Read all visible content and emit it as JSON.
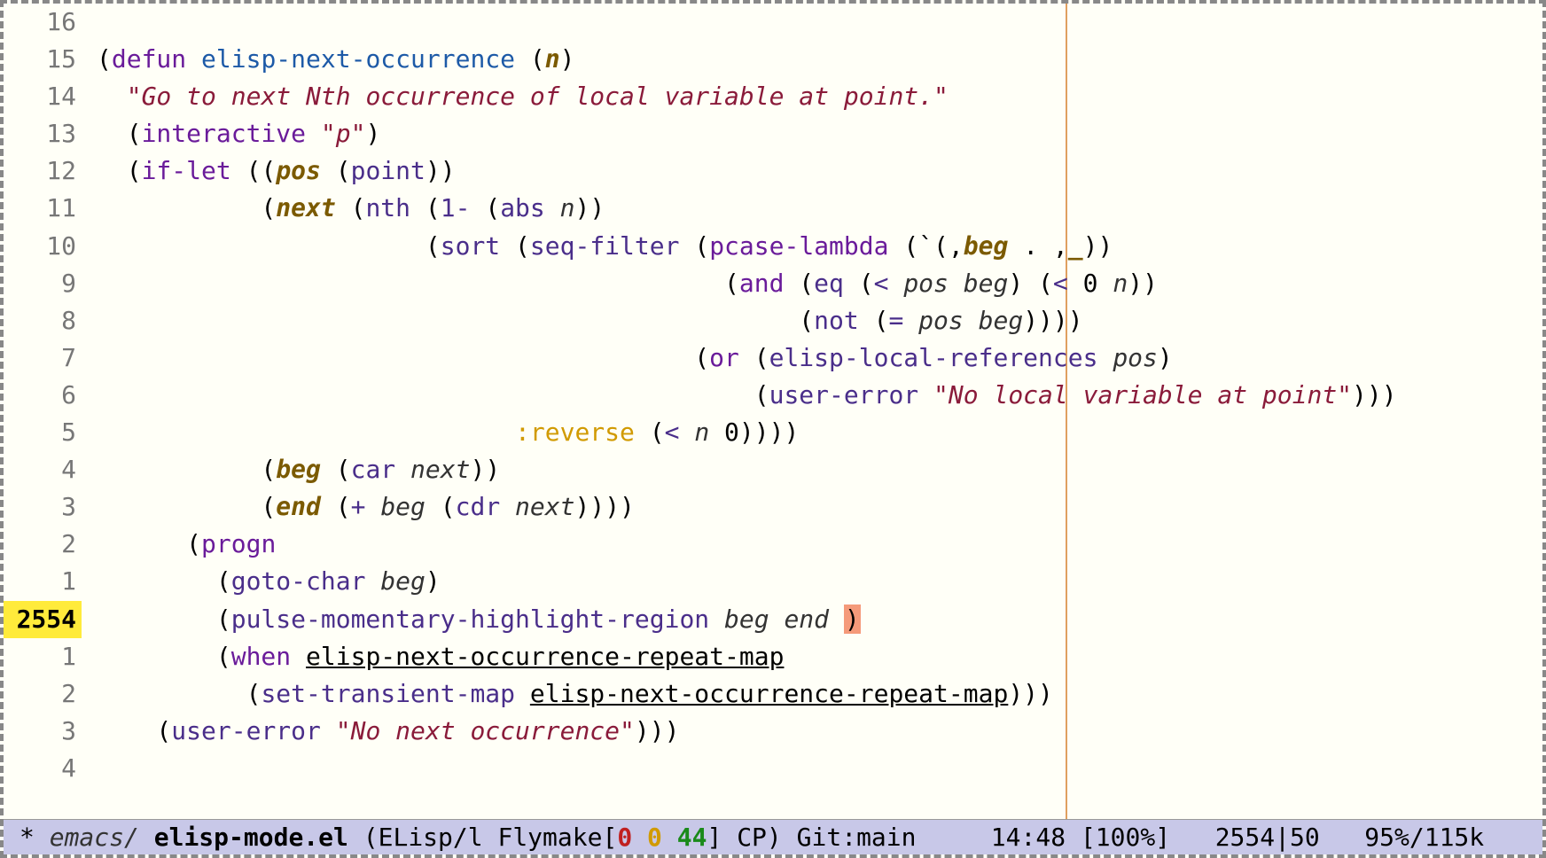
{
  "line_numbers": [
    "16",
    "15",
    "14",
    "13",
    "12",
    "11",
    "10",
    "9",
    "8",
    "7",
    "6",
    "5",
    "4",
    "3",
    "2",
    "1",
    "2554",
    "1",
    "2",
    "3",
    "4"
  ],
  "current_line_index": 16,
  "code": {
    "l0": "",
    "l1_a": "(",
    "l1_b": "defun",
    "l1_c": " ",
    "l1_d": "elisp-next-occurrence",
    "l1_e": " (",
    "l1_f": "n",
    "l1_g": ")",
    "l2_a": "  ",
    "l2_b": "\"Go to next Nth occurrence of local variable at point.\"",
    "l3_a": "  (",
    "l3_b": "interactive",
    "l3_c": " ",
    "l3_d": "\"p\"",
    "l3_e": ")",
    "l4_a": "  (",
    "l4_b": "if-let",
    "l4_c": " ((",
    "l4_d": "pos",
    "l4_e": " (",
    "l4_f": "point",
    "l4_g": "))",
    "l5_a": "           (",
    "l5_b": "next",
    "l5_c": " (",
    "l5_d": "nth",
    "l5_e": " (",
    "l5_f": "1-",
    "l5_g": " (",
    "l5_h": "abs",
    "l5_i": " ",
    "l5_j": "n",
    "l5_k": "))",
    "l6_a": "                      (",
    "l6_b": "sort",
    "l6_c": " (",
    "l6_d": "seq-filter",
    "l6_e": " (",
    "l6_f": "pcase-lambda",
    "l6_g": " (`(,",
    "l6_h": "beg",
    "l6_i": " . ,",
    "l6_j": "_",
    "l6_k": "))",
    "l7_a": "                                          (",
    "l7_b": "and",
    "l7_c": " (",
    "l7_d": "eq",
    "l7_e": " (",
    "l7_f": "<",
    "l7_g": " ",
    "l7_h": "pos",
    "l7_i": " ",
    "l7_j": "beg",
    "l7_k": ") (",
    "l7_l": "<",
    "l7_m": " 0 ",
    "l7_n": "n",
    "l7_o": "))",
    "l8_a": "                                               (",
    "l8_b": "not",
    "l8_c": " (",
    "l8_d": "=",
    "l8_e": " ",
    "l8_f": "pos",
    "l8_g": " ",
    "l8_h": "beg",
    "l8_i": "))))",
    "l9_a": "                                        (",
    "l9_b": "or",
    "l9_c": " (",
    "l9_d": "elisp-local-references",
    "l9_e": " ",
    "l9_f": "pos",
    "l9_g": ")",
    "l10_a": "                                            (",
    "l10_b": "user-error",
    "l10_c": " ",
    "l10_d": "\"No local variable at point\"",
    "l10_e": ")))",
    "l11_a": "                            ",
    "l11_b": ":reverse",
    "l11_c": " (",
    "l11_d": "<",
    "l11_e": " ",
    "l11_f": "n",
    "l11_g": " 0))))",
    "l12_a": "           (",
    "l12_b": "beg",
    "l12_c": " (",
    "l12_d": "car",
    "l12_e": " ",
    "l12_f": "next",
    "l12_g": "))",
    "l13_a": "           (",
    "l13_b": "end",
    "l13_c": " (",
    "l13_d": "+",
    "l13_e": " ",
    "l13_f": "beg",
    "l13_g": " (",
    "l13_h": "cdr",
    "l13_i": " ",
    "l13_j": "next",
    "l13_k": "))))",
    "l14_a": "      (",
    "l14_b": "progn",
    "l15_a": "        (",
    "l15_b": "goto-char",
    "l15_c": " ",
    "l15_d": "beg",
    "l15_e": ")",
    "l16_a": "        (",
    "l16_b": "pulse-momentary-highlight-region",
    "l16_c": " ",
    "l16_d": "beg",
    "l16_e": " ",
    "l16_f": "end",
    "l16_g": " ",
    "l16_h": ")",
    "l17_a": "        (",
    "l17_b": "when",
    "l17_c": " ",
    "l17_d": "elisp-next-occurrence-repeat-map",
    "l18_a": "          (",
    "l18_b": "set-transient-map",
    "l18_c": " ",
    "l18_d": "elisp-next-occurrence-repeat-map",
    "l18_e": ")))",
    "l19_a": "    (",
    "l19_b": "user-error",
    "l19_c": " ",
    "l19_d": "\"No next occurrence\"",
    "l19_e": ")))",
    "l20": ""
  },
  "modeline": {
    "modified": "*",
    "dir": "emacs/",
    "file": "elisp-mode.el",
    "mode_open": " (ELisp/l Flymake[",
    "fly0": "0",
    "fly1": "0",
    "fly2": "44",
    "mode_close": "] CP) ",
    "vc": "Git:main",
    "time": "14:48",
    "battery": "[100%]",
    "pos": "2554|50",
    "pct": "95%/115k"
  }
}
